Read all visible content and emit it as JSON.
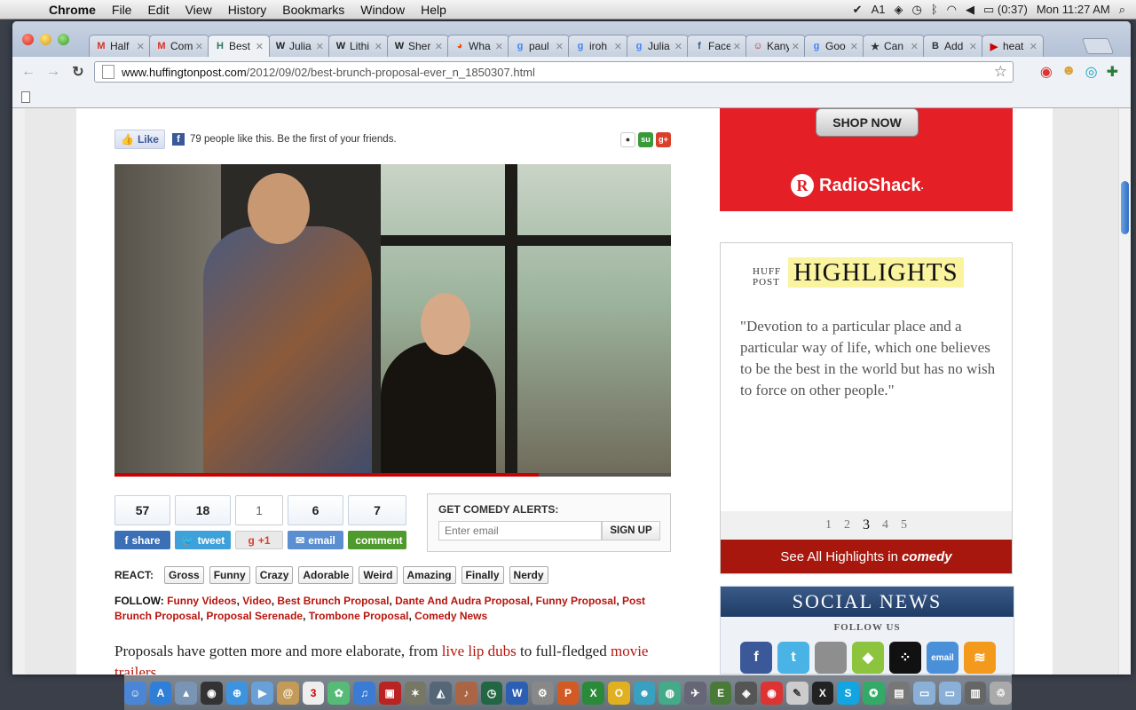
{
  "menubar": {
    "apple": "",
    "app": "Chrome",
    "items": [
      "File",
      "Edit",
      "View",
      "History",
      "Bookmarks",
      "Window",
      "Help"
    ],
    "status": {
      "adobe_count": "1",
      "battery": "(0:37)",
      "clock": "Mon 11:27 AM"
    }
  },
  "tabs": [
    {
      "label": "Half",
      "icon": "gmail-icon",
      "color": "#d93025"
    },
    {
      "label": "Com",
      "icon": "gmail-icon",
      "color": "#d93025"
    },
    {
      "label": "Best",
      "icon": "huffpost-icon",
      "color": "#2e7061",
      "active": true
    },
    {
      "label": "Julia",
      "icon": "wikipedia-icon",
      "color": "#222222"
    },
    {
      "label": "Lithi",
      "icon": "wikipedia-icon",
      "color": "#222222"
    },
    {
      "label": "Sher",
      "icon": "wikipedia-icon",
      "color": "#222222"
    },
    {
      "label": "Wha",
      "icon": "reddit-icon",
      "color": "#ff4500"
    },
    {
      "label": "paul",
      "icon": "google-icon",
      "color": "#4285f4"
    },
    {
      "label": "iroh",
      "icon": "google-icon",
      "color": "#4285f4"
    },
    {
      "label": "Julia",
      "icon": "google-icon",
      "color": "#4285f4"
    },
    {
      "label": "Face",
      "icon": "facebook-icon",
      "color": "#3b5998"
    },
    {
      "label": "Kany",
      "icon": "person-icon",
      "color": "#a33"
    },
    {
      "label": "Goo",
      "icon": "google-icon",
      "color": "#4285f4"
    },
    {
      "label": "Can",
      "icon": "star-icon",
      "color": "#333333"
    },
    {
      "label": "Add",
      "icon": "bold-b-icon",
      "color": "#333333"
    },
    {
      "label": "heat",
      "icon": "youtube-icon",
      "color": "#cc0000"
    }
  ],
  "address": {
    "host": "www.huffingtonpost.com",
    "path": "/2012/09/02/best-brunch-proposal-ever_n_1850307.html"
  },
  "fb": {
    "like": "Like",
    "text": "79 people like this. Be the first of your friends."
  },
  "counts": [
    {
      "num": "57",
      "label": "share",
      "color": "#3b6fb6",
      "icon": "facebook-icon"
    },
    {
      "num": "18",
      "label": "tweet",
      "color": "#3fa1d9",
      "icon": "twitter-icon"
    },
    {
      "num": "1",
      "label": "+1",
      "color": "#e9e9e9",
      "icon": "google-plus-icon"
    },
    {
      "num": "6",
      "label": "email",
      "color": "#5b8fd1",
      "icon": "email-icon"
    },
    {
      "num": "7",
      "label": "comment",
      "color": "#4f9a2c",
      "icon": "comment-icon"
    }
  ],
  "alerts": {
    "heading": "GET COMEDY ALERTS:",
    "placeholder": "Enter email",
    "button": "SIGN UP"
  },
  "react": {
    "label": "REACT:",
    "buttons": [
      "Gross",
      "Funny",
      "Crazy",
      "Adorable",
      "Weird",
      "Amazing",
      "Finally",
      "Nerdy"
    ]
  },
  "follow": {
    "label": "FOLLOW:",
    "links": [
      "Funny Videos",
      "Video",
      "Best Brunch Proposal",
      "Dante And Audra Proposal",
      "Funny Proposal",
      "Post Brunch Proposal",
      "Proposal Serenade",
      "Trombone Proposal",
      "Comedy News"
    ]
  },
  "article": {
    "p1_a": "Proposals have gotten more and more elaborate, from ",
    "p1_link1": "live lip dubs",
    "p1_b": " to full-fledged ",
    "p1_link2": "movie trailers"
  },
  "ad": {
    "button": "SHOP NOW",
    "brand": "RadioShack",
    "brand_mark": "R",
    "tm": "."
  },
  "highlights": {
    "huff": "HUFF",
    "post": "POST",
    "title": "HIGHLIGHTS",
    "quote": "\"Devotion to a particular place and a particular way of life, which one believes to be the best in the world but has no wish to force on other people.\"",
    "pages": [
      "1",
      "2",
      "3",
      "4",
      "5"
    ],
    "current_page": "3",
    "see_all_prefix": "See All Highlights in",
    "see_all_section": "comedy"
  },
  "social": {
    "title": "SOCIAL NEWS",
    "follow": "FOLLOW US",
    "icons": [
      {
        "name": "facebook-icon",
        "glyph": "f",
        "color": "#3b5998"
      },
      {
        "name": "twitter-icon",
        "glyph": "t",
        "color": "#4ab3e6"
      },
      {
        "name": "apple-icon",
        "glyph": "",
        "color": "#8e8e8e"
      },
      {
        "name": "android-icon",
        "glyph": "◆",
        "color": "#8cc43e"
      },
      {
        "name": "blackberry-icon",
        "glyph": "⁘",
        "color": "#111111"
      },
      {
        "name": "email-icon",
        "glyph": "email",
        "color": "#4a90d9"
      },
      {
        "name": "rss-icon",
        "glyph": "≋",
        "color": "#f39a1d"
      }
    ]
  }
}
